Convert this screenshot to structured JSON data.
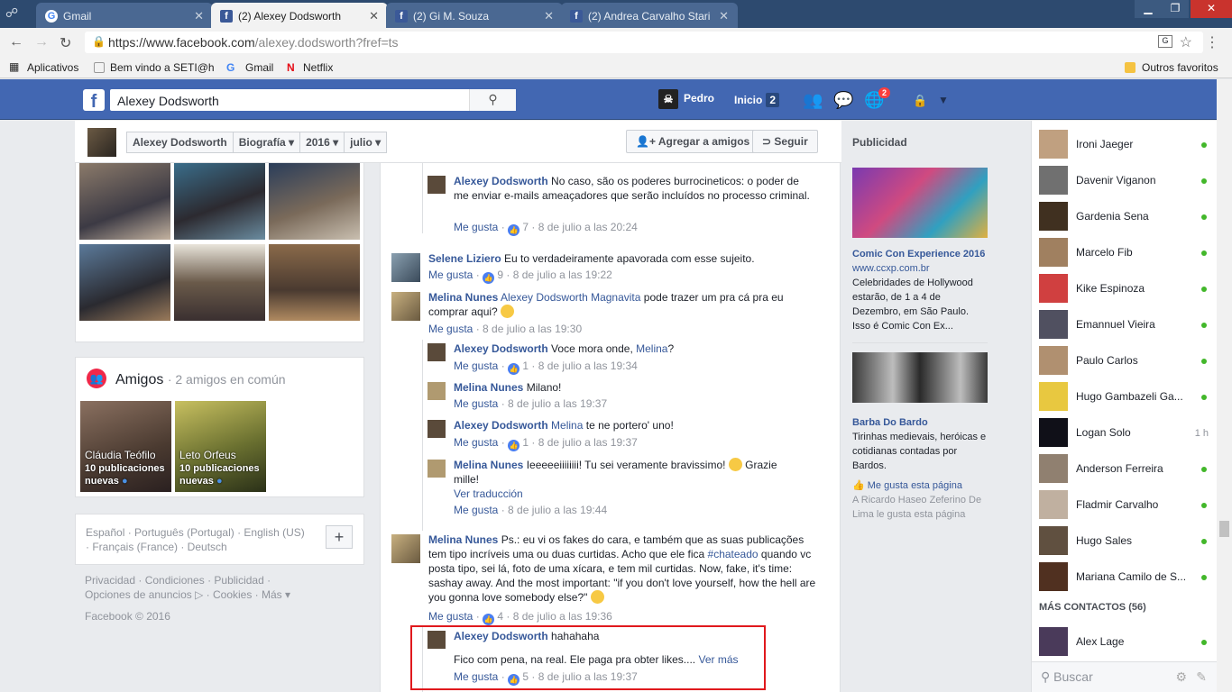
{
  "browser": {
    "tabs": [
      {
        "label": "Gmail",
        "icon": "google-icon"
      },
      {
        "label": "(2) Alexey Dodsworth",
        "icon": "facebook-icon"
      },
      {
        "label": "(2) Gi M. Souza",
        "icon": "facebook-icon"
      },
      {
        "label": "(2) Andrea Carvalho Stari",
        "icon": "facebook-icon"
      }
    ],
    "url_host": "https://www.facebook.com",
    "url_path": "/alexey.dodsworth?fref=ts",
    "bookmarks": [
      "Aplicativos",
      "Bem vindo a SETI@ho",
      "Gmail",
      "Netflix"
    ],
    "other_bookmarks": "Outros favoritos"
  },
  "fb": {
    "search_value": "Alexey Dodsworth",
    "user": "Pedro",
    "home": "Inicio",
    "home_count": "2",
    "notif_count": "2"
  },
  "timeline": {
    "crumbs": [
      "Alexey Dodsworth",
      "Biografía",
      "2016",
      "julio"
    ],
    "add_friend": "Agregar a amigos",
    "follow": "Seguir"
  },
  "friends": {
    "title": "Amigos",
    "subtitle": "· 2 amigos en común",
    "items": [
      {
        "name": "Cláudia Teófilo",
        "desc1": "10 publicaciones",
        "desc2": "nuevas"
      },
      {
        "name": "Leto Orfeus",
        "desc1": "10 publicaciones",
        "desc2": "nuevas"
      }
    ]
  },
  "langs": {
    "line1": "Español · Português (Portugal) · English (US)",
    "line2": "· Français (France) · Deutsch"
  },
  "footer": {
    "line1": "Privacidad · Condiciones · Publicidad ·",
    "line2": "Opciones de anuncios ▷ · Cookies · Más ▾",
    "copy": "Facebook © 2016"
  },
  "comments": [
    {
      "name": "Alexey Dodsworth",
      "text": "No caso, são os poderes burrocineticos: o poder de me enviar e-mails ameaçadores que serão incluídos no processo criminal.",
      "likes": "7",
      "date": "8 de julio a las 20:24"
    },
    {
      "name": "Selene Liziero",
      "text": "Eu to verdadeiramente apavorada com esse sujeito.",
      "likes": "9",
      "date": "8 de julio a las 19:22"
    },
    {
      "name": "Melina Nunes",
      "mention": "Alexey Dodsworth Magnavita",
      "text": "pode trazer um pra cá pra eu comprar aqui?",
      "date": "8 de julio a las 19:30"
    },
    {
      "name": "Alexey Dodsworth",
      "text": "Voce mora onde,",
      "mention": "Melina",
      "text2": "?",
      "likes": "1",
      "date": "8 de julio a las 19:34"
    },
    {
      "name": "Melina Nunes",
      "text": "Milano!",
      "date": "8 de julio a las 19:37"
    },
    {
      "name": "Alexey Dodsworth",
      "mention": "Melina",
      "text": "te ne portero' uno!",
      "likes": "1",
      "date": "8 de julio a las 19:37"
    },
    {
      "name": "Melina Nunes",
      "text": "Ieeeeeiiiiiiii! Tu sei veramente bravissimo!",
      "text2": "Grazie mille!",
      "translate": "Ver traducción",
      "date": "8 de julio a las 19:44"
    },
    {
      "name": "Melina Nunes",
      "text": "Ps.: eu vi os fakes do cara, e também que as suas publicações tem tipo incríveis uma ou duas curtidas. Acho que ele fica",
      "hashtag": "#chateado",
      "text2": "quando vc posta tipo, sei lá, foto de uma xícara, e tem mil curtidas. Now, fake, it's time: sashay away. And the most important: \"if you don't love yourself, how the hell are you gonna love somebody else?\"",
      "likes": "4",
      "date": "8 de julio a las 19:36"
    },
    {
      "name": "Alexey Dodsworth",
      "text": "hahahaha",
      "text2": "Fico com pena, na real. Ele paga pra obter likes....",
      "more": "Ver más",
      "likes": "5",
      "date": "8 de julio a las 19:37"
    }
  ],
  "like_label": "Me gusta",
  "ads": {
    "header": "Publicidad",
    "ad1": {
      "title": "Comic Con Experience 2016",
      "url": "www.ccxp.com.br",
      "body": "Celebridades de Hollywood estarão, de 1 a 4 de Dezembro, em São Paulo. Isso é Comic Con Ex..."
    },
    "ad2": {
      "title": "Barba Do Bardo",
      "body": "Tirinhas medievais, heróicas e cotidianas contadas por Bardos.",
      "cta": "Me gusta esta página",
      "social": "A Ricardo Haseo Zeferino De Lima le gusta esta página"
    }
  },
  "chat": {
    "contacts": [
      {
        "name": "Ironi Jaeger"
      },
      {
        "name": "Davenir Viganon"
      },
      {
        "name": "Gardenia Sena"
      },
      {
        "name": "Marcelo Fib"
      },
      {
        "name": "Kike Espinoza"
      },
      {
        "name": "Emannuel Vieira"
      },
      {
        "name": "Paulo Carlos"
      },
      {
        "name": "Hugo Gambazeli Ga..."
      },
      {
        "name": "Logan Solo",
        "time": "1 h"
      },
      {
        "name": "Anderson Ferreira"
      },
      {
        "name": "Fladmir Carvalho"
      },
      {
        "name": "Hugo Sales"
      },
      {
        "name": "Mariana Camilo de S..."
      }
    ],
    "more_label": "MÁS CONTACTOS (56)",
    "extra": "Alex Lage",
    "search_placeholder": "Buscar"
  }
}
